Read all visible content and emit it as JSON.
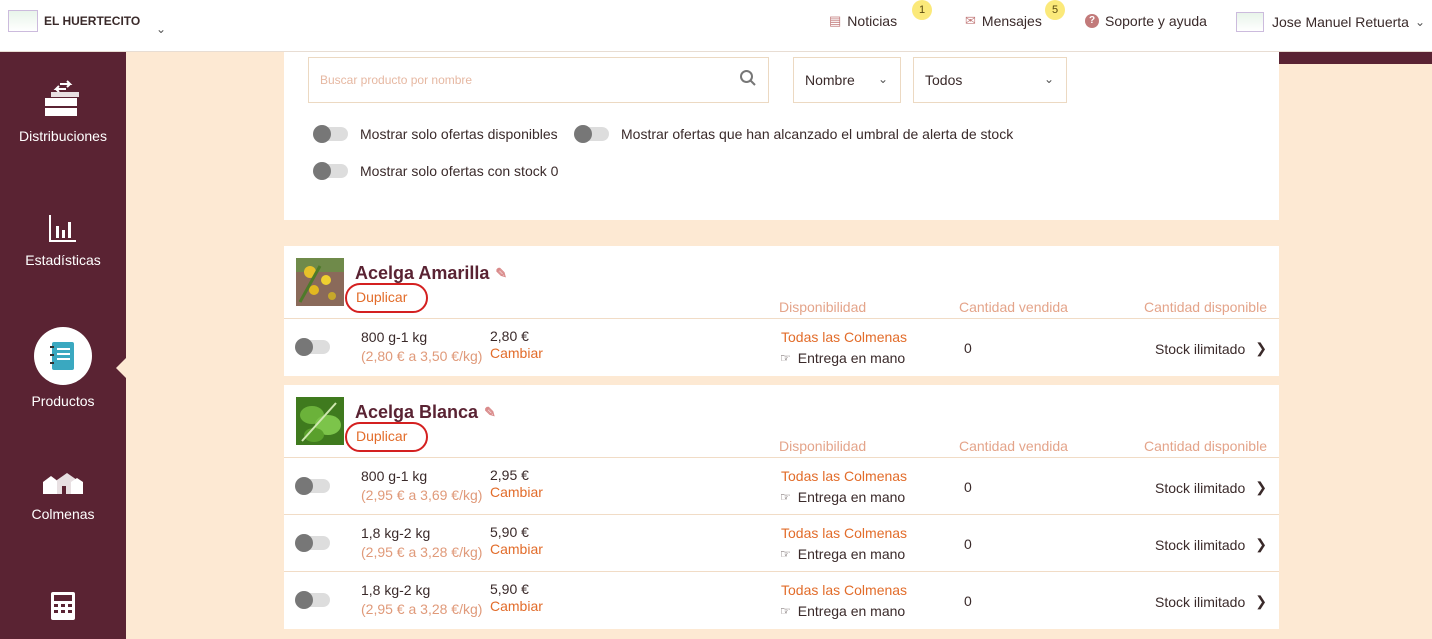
{
  "header": {
    "brand_name": "EL HUERTECITO",
    "news_label": "Noticias",
    "news_count": "1",
    "messages_label": "Mensajes",
    "messages_count": "5",
    "help_label": "Soporte y ayuda",
    "user_name": "Jose Manuel Retuerta"
  },
  "sidebar": {
    "items": [
      {
        "label": "Distribuciones"
      },
      {
        "label": "Estadísticas"
      },
      {
        "label": "Productos"
      },
      {
        "label": "Colmenas"
      }
    ]
  },
  "filters": {
    "search_placeholder": "Buscar producto por nombre",
    "sort_value": "Nombre",
    "scope_value": "Todos",
    "toggle_available": "Mostrar solo ofertas disponibles",
    "toggle_stock_alert": "Mostrar ofertas que han alcanzado el umbral de alerta de stock",
    "toggle_stock_zero": "Mostrar solo ofertas con stock 0"
  },
  "columns": {
    "availability": "Disponibilidad",
    "sold": "Cantidad vendida",
    "available_qty": "Cantidad disponible"
  },
  "products": [
    {
      "name": "Acelga Amarilla",
      "duplicate_label": "Duplicar",
      "offers": [
        {
          "weight": "800 g-1 kg",
          "per_kg": "(2,80 € a 3,50 €/kg)",
          "price": "2,80 €",
          "change_label": "Cambiar",
          "availability": "Todas las Colmenas",
          "delivery": "Entrega en mano",
          "sold": "0",
          "stock": "Stock ilimitado"
        }
      ]
    },
    {
      "name": "Acelga Blanca",
      "duplicate_label": "Duplicar",
      "offers": [
        {
          "weight": "800 g-1 kg",
          "per_kg": "(2,95 € a 3,69 €/kg)",
          "price": "2,95 €",
          "change_label": "Cambiar",
          "availability": "Todas las Colmenas",
          "delivery": "Entrega en mano",
          "sold": "0",
          "stock": "Stock ilimitado"
        },
        {
          "weight": "1,8 kg-2 kg",
          "per_kg": "(2,95 € a 3,28 €/kg)",
          "price": "5,90 €",
          "change_label": "Cambiar",
          "availability": "Todas las Colmenas",
          "delivery": "Entrega en mano",
          "sold": "0",
          "stock": "Stock ilimitado"
        },
        {
          "weight": "1,8 kg-2 kg",
          "per_kg": "(2,95 € a 3,28 €/kg)",
          "price": "5,90 €",
          "change_label": "Cambiar",
          "availability": "Todas las Colmenas",
          "delivery": "Entrega en mano",
          "sold": "0",
          "stock": "Stock ilimitado"
        }
      ]
    }
  ]
}
